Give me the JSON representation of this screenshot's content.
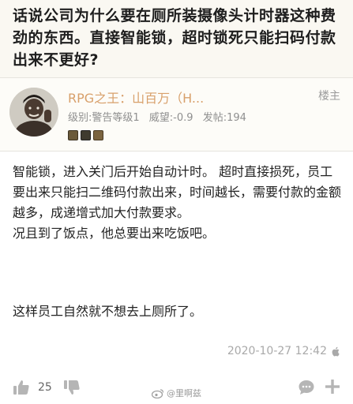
{
  "thread": {
    "title": "话说公司为什么要在厕所装摄像头计时器这种费劲的东西。直接智能锁，超时锁死只能扫码付款出来不更好?"
  },
  "post": {
    "author": "RPG之王：山百万（H...",
    "op_badge": "楼主",
    "level": "级别:警告等级1",
    "prestige": "威望:-0.9",
    "post_count": "发帖:194",
    "body": [
      "智能锁，进入关门后开始自动计时。 超时直接损死，员工要出来只能扫二维码付款出来，时间越长，需要付款的金额越多，成递增式加大付款要求。",
      "况且到了饭点，他总要出来吃饭吧。"
    ],
    "closing_line": "这样员工自然就不想去上厕所了。",
    "timestamp": "2020-10-27 12:42",
    "timestamp_icon": "apple-icon"
  },
  "actions": {
    "like_count": "25",
    "icons": [
      "thumbs-up-icon",
      "thumbs-down-icon",
      "comment-icon",
      "add-icon"
    ]
  },
  "watermark": {
    "text": "@里啊兹"
  },
  "colors": {
    "username": "#d8a06b",
    "title_background": "#faf8f2",
    "meta_text": "#8f8f8f",
    "timestamp": "#a9a9a9",
    "icon_gray": "#b5b5b5"
  }
}
